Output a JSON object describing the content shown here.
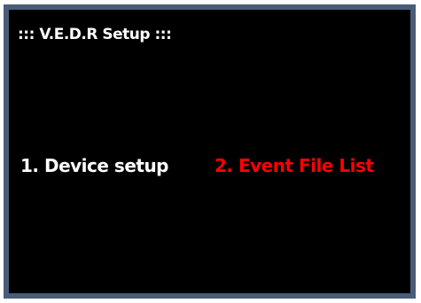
{
  "screen": {
    "title": "::: V.E.D.R Setup :::"
  },
  "menu": {
    "items": [
      {
        "label": "1. Device setup",
        "color": "#ffffff",
        "selected": false
      },
      {
        "label": "2. Event File List",
        "color": "#ff0000",
        "selected": true
      }
    ]
  },
  "colors": {
    "background": "#000000",
    "border": "#4a5d78",
    "text": "#ffffff",
    "highlight": "#ff0000"
  }
}
